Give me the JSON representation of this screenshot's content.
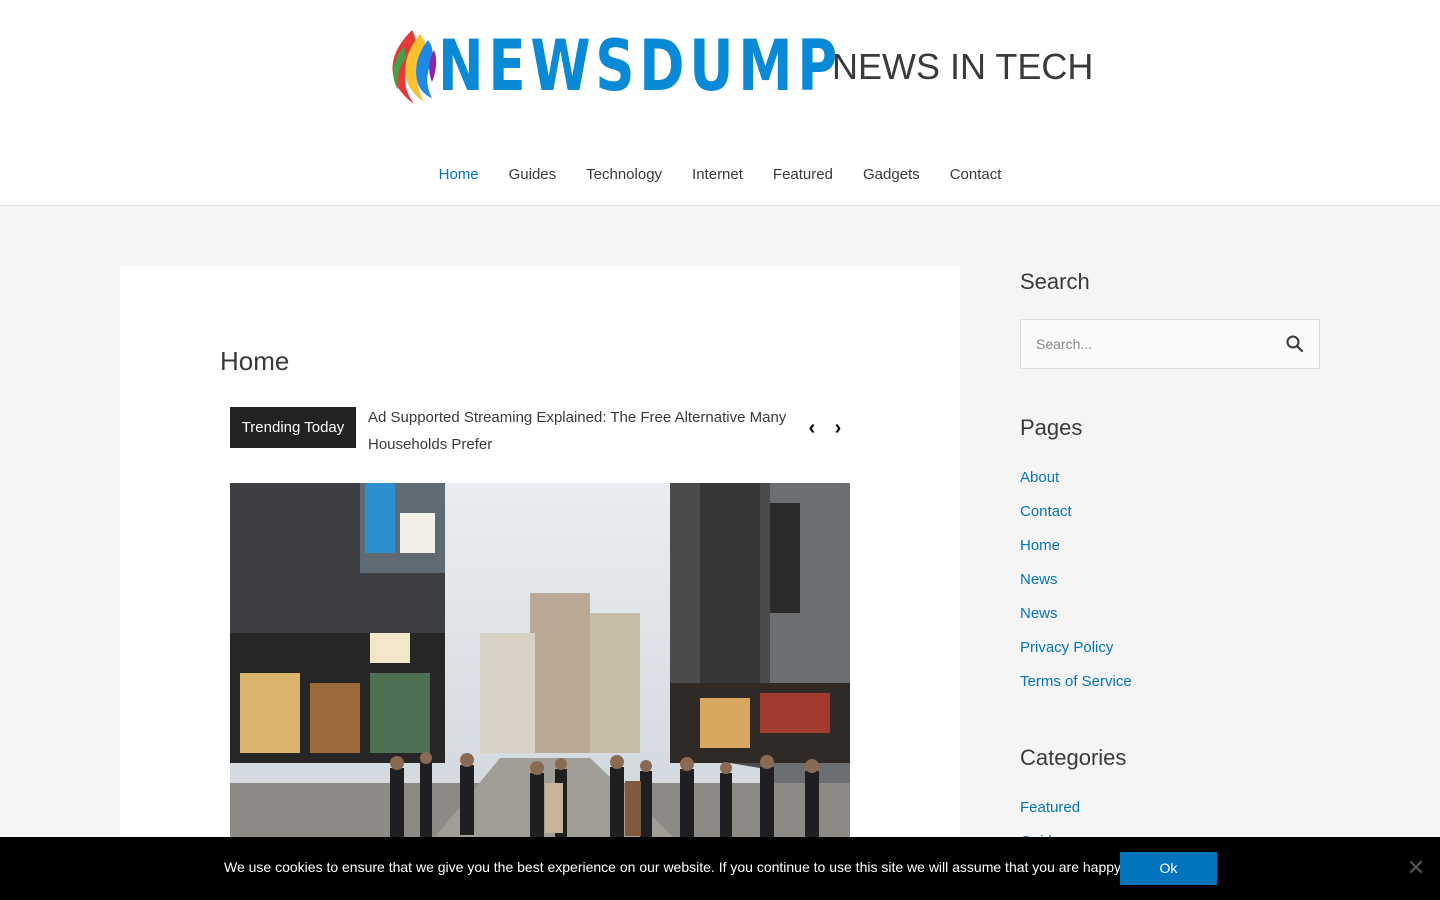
{
  "header": {
    "logo_text": "NEWSDUMP",
    "tagline": "NEWS IN TECH"
  },
  "nav": [
    {
      "label": "Home",
      "active": true
    },
    {
      "label": "Guides"
    },
    {
      "label": "Technology"
    },
    {
      "label": "Internet"
    },
    {
      "label": "Featured"
    },
    {
      "label": "Gadgets"
    },
    {
      "label": "Contact"
    }
  ],
  "main": {
    "page_title": "Home",
    "ticker": {
      "label": "Trending Today",
      "headline": "Ad Supported Streaming Explained: The Free Alternative Many Households Prefer",
      "prev_icon": "chevron-left-icon",
      "next_icon": "chevron-right-icon"
    },
    "hero_image": "street-scene-photo"
  },
  "sidebar": {
    "search": {
      "title": "Search",
      "placeholder": "Search...",
      "icon": "search-icon"
    },
    "pages": {
      "title": "Pages",
      "items": [
        "About",
        "Contact",
        "Home",
        "News",
        "News",
        "Privacy Policy",
        "Terms of Service"
      ]
    },
    "categories": {
      "title": "Categories",
      "items": [
        "Featured",
        "Guides"
      ]
    }
  },
  "cookie": {
    "text": "We use cookies to ensure that we give you the best experience on our website. If you continue to use this site we will assume that you are happy with it.",
    "ok_label": "Ok",
    "close_icon": "close-icon"
  },
  "colors": {
    "accent": "#0274be",
    "logo_blue": "#0a8ad6",
    "cookie_bg": "#000000",
    "ticker_label_bg": "#222222"
  }
}
